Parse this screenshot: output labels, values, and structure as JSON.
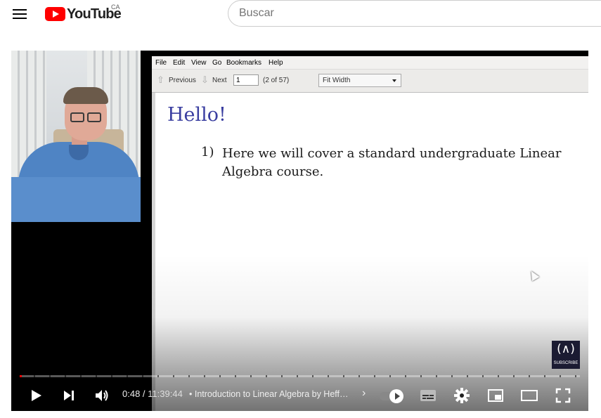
{
  "masthead": {
    "logo_text": "YouTube",
    "country": "CA",
    "search_placeholder": "Buscar"
  },
  "viewer": {
    "menu": [
      "File",
      "Edit",
      "View",
      "Go",
      "Bookmarks",
      "Help"
    ],
    "toolbar": {
      "previous_label": "Previous",
      "next_label": "Next",
      "page_value": "1",
      "page_count": "(2 of 57)",
      "zoom_value": "Fit Width"
    },
    "document": {
      "title": "Hello!",
      "item_number": "1)",
      "item_text": "Here we will cover a standard undergraduate Linear Algebra course."
    }
  },
  "watermark": {
    "glyph": "(∧)",
    "text": "SUBSCRIBE"
  },
  "player": {
    "current_time": "0:48",
    "separator": " / ",
    "duration": "11:39:44",
    "chapter_title": "• Introduction to Linear Algebra by Heff…",
    "chapter_chevron": "›",
    "progress_fraction": 0.0011,
    "icons": [
      "play-icon",
      "next-icon",
      "volume-icon",
      "autoplay-toggle",
      "subtitles-icon",
      "settings-icon",
      "miniplayer-icon",
      "theater-icon",
      "fullscreen-icon"
    ],
    "accent_color": "#ff0000"
  }
}
